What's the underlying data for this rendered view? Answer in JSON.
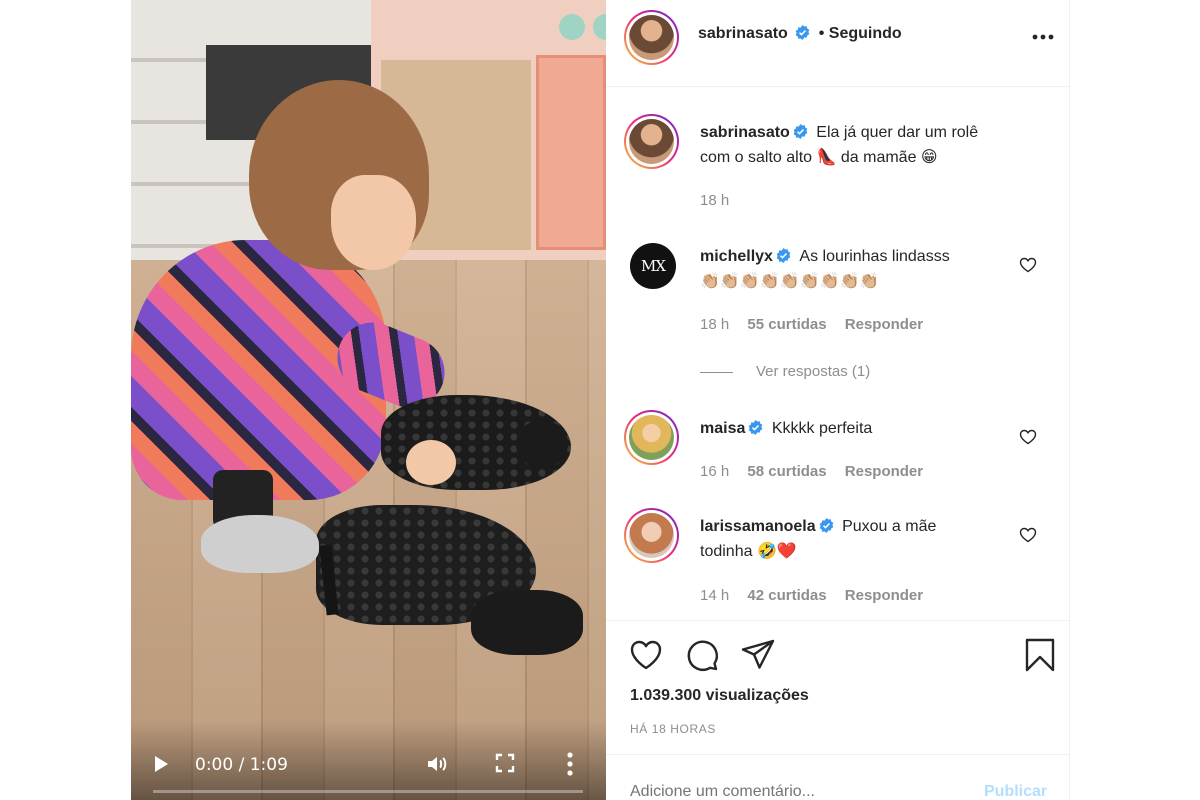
{
  "post": {
    "author": "sabrinasato",
    "follow_status": "• Seguindo",
    "caption": "Ela já quer dar um rolê com o salto alto 👠 da mamãe 😁",
    "caption_line1": "Ela já quer dar um rolê",
    "caption_line2": "com o salto alto 👠 da mamãe 😁",
    "caption_time": "18 h",
    "views": "1.039.300 visualizações",
    "posted_ago": "HÁ 18 HORAS"
  },
  "video": {
    "time": "0:00 / 1:09",
    "progress": 0
  },
  "comments": [
    {
      "user": "michellyx",
      "avatar_text": "MX",
      "line1": "As lourinhas lindasss",
      "line2": "👏🏼👏🏼👏🏼👏🏼👏🏼👏🏼👏🏼👏🏼👏🏼",
      "time": "18 h",
      "likes": "55 curtidas",
      "reply": "Responder",
      "view_replies": "Ver respostas (1)"
    },
    {
      "user": "maisa",
      "line1": "Kkkkk perfeita",
      "time": "16 h",
      "likes": "58 curtidas",
      "reply": "Responder"
    },
    {
      "user": "larissamanoela",
      "line1": "Puxou a mãe",
      "line2": "todinha 🤣❤️",
      "time": "14 h",
      "likes": "42 curtidas",
      "reply": "Responder"
    }
  ],
  "add_comment": {
    "placeholder": "Adicione um comentário...",
    "publish": "Publicar"
  },
  "colors": {
    "verified": "#3897f0",
    "publish_disabled": "#b2dffc",
    "text": "#262626",
    "muted": "#8e8e8e"
  },
  "icons": [
    "verified-icon",
    "more-options-icon",
    "heart-icon",
    "comment-icon",
    "share-icon",
    "bookmark-icon",
    "play-icon",
    "volume-icon",
    "fullscreen-icon"
  ]
}
